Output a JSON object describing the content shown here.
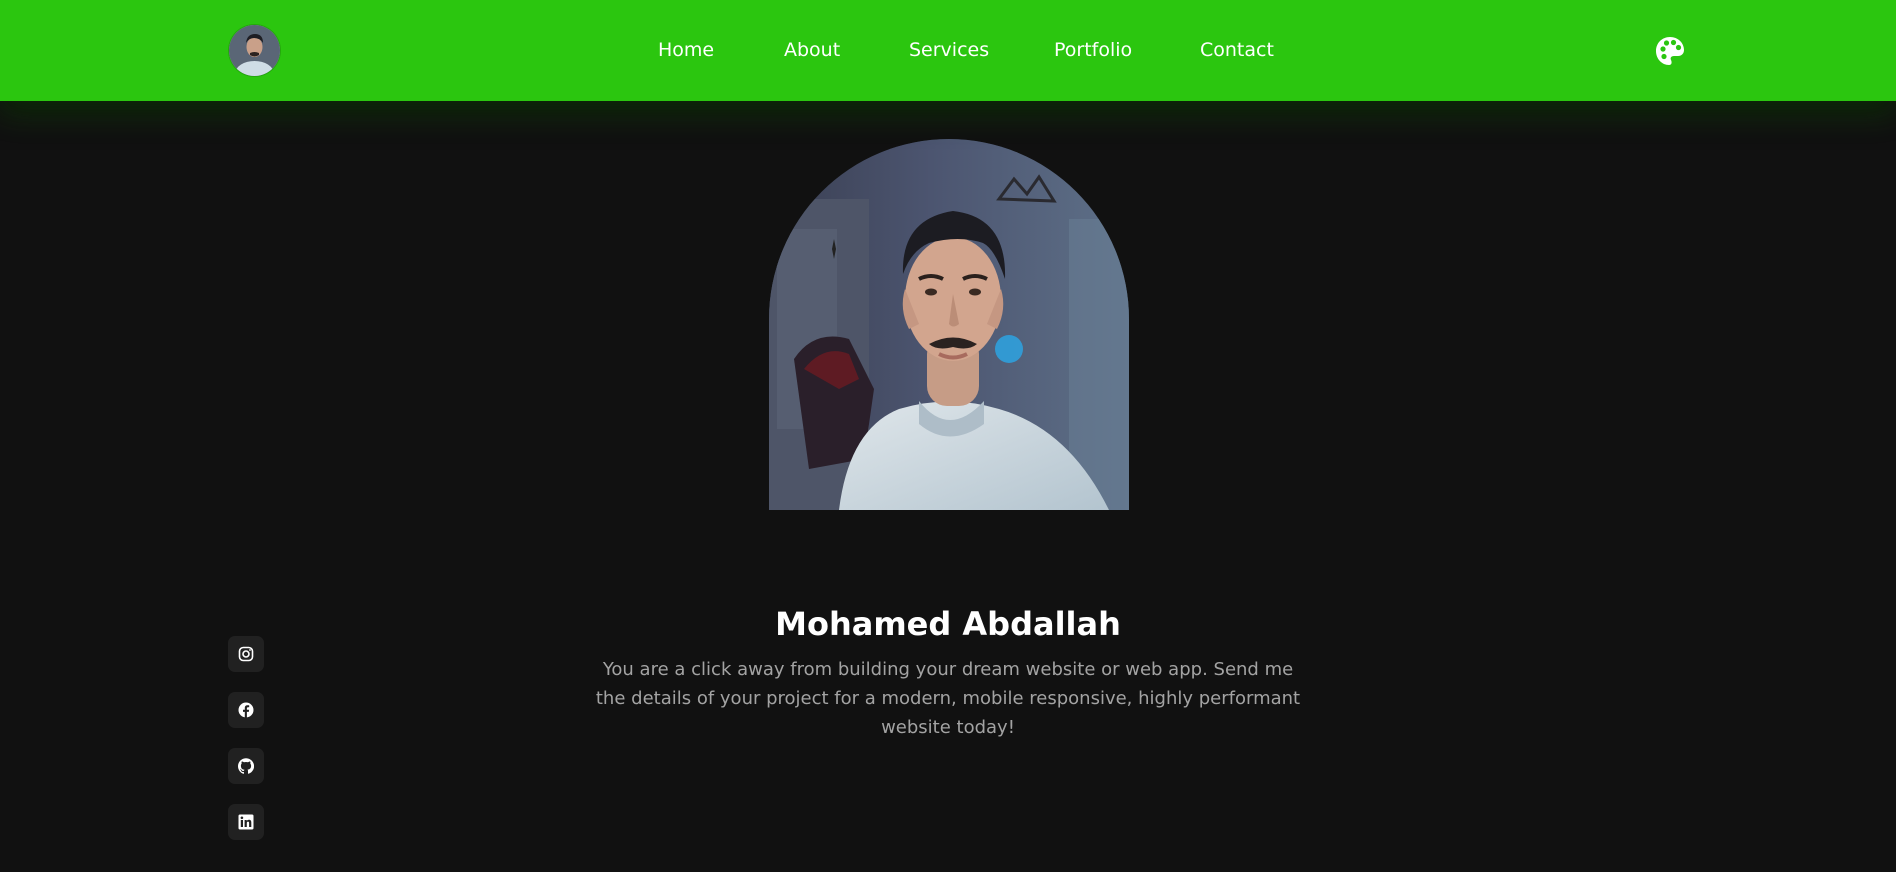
{
  "nav": {
    "items": [
      {
        "label": "Home"
      },
      {
        "label": "About"
      },
      {
        "label": "Services"
      },
      {
        "label": "Portfolio"
      },
      {
        "label": "Contact"
      }
    ],
    "avatar_icon": "profile-avatar",
    "theme_icon": "palette-icon"
  },
  "hero": {
    "name": "Mohamed Abdallah",
    "description": "You are a click away from building your dream website or web app. Send me the details of your project for a modern, mobile responsive, highly performant website today!"
  },
  "social": [
    {
      "icon": "instagram-icon"
    },
    {
      "icon": "facebook-icon"
    },
    {
      "icon": "github-icon"
    },
    {
      "icon": "linkedin-icon"
    }
  ],
  "colors": {
    "accent": "#2bc60f",
    "background": "#111111",
    "text": "#ffffff",
    "muted_text": "#a3a3a3",
    "social_bg": "#212121"
  }
}
